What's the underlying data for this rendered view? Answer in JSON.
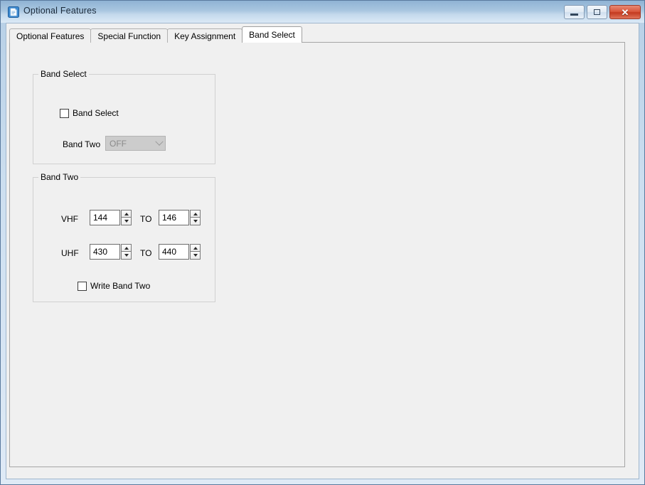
{
  "window": {
    "title": "Optional Features",
    "icon": "document-blue-icon",
    "buttons": {
      "minimize": "minimize-icon",
      "maximize": "maximize-icon",
      "close": "✕"
    }
  },
  "tabs": [
    {
      "label": "Optional Features",
      "active": false
    },
    {
      "label": "Special Function",
      "active": false
    },
    {
      "label": "Key Assignment",
      "active": false
    },
    {
      "label": "Band Select",
      "active": true
    }
  ],
  "band_select_group": {
    "title": "Band Select",
    "checkbox": {
      "label": "Band Select",
      "checked": false
    },
    "band_two": {
      "label": "Band Two",
      "value": "OFF",
      "disabled": true,
      "arrow_icon": "chevron-down-icon"
    }
  },
  "band_two_group": {
    "title": "Band Two",
    "rows": [
      {
        "label": "VHF",
        "from": "144",
        "separator": "TO",
        "to": "146"
      },
      {
        "label": "UHF",
        "from": "430",
        "separator": "TO",
        "to": "440"
      }
    ],
    "write_checkbox": {
      "label": "Write Band Two",
      "checked": false
    }
  },
  "colors": {
    "titlebar_top": "#8fb3d4",
    "titlebar_bottom": "#dbe9f6",
    "window_frame": "#b6cfe6",
    "panel_bg": "#f0f0f0",
    "active_tab_bg": "#ffffff",
    "close_button": "#c33a20",
    "disabled_combo_bg": "#cccccc",
    "disabled_combo_text": "#8a8a8a",
    "groupbox_border": "#d0d0d0"
  }
}
